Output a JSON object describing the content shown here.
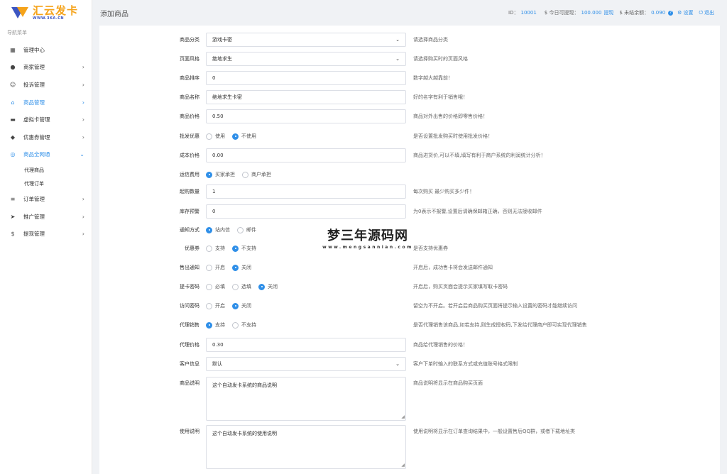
{
  "brand": {
    "title": "汇云发卡",
    "subtitle": "WWW.3KA.CN"
  },
  "sidebar": {
    "caption": "导航菜单",
    "items": [
      {
        "icon": "dashboard-icon",
        "glyph": "▦",
        "label": "管理中心"
      },
      {
        "icon": "user-icon",
        "glyph": "●",
        "label": "商家管理",
        "chevron": "›"
      },
      {
        "icon": "face-icon",
        "glyph": "☺",
        "label": "投诉管理",
        "chevron": "›"
      },
      {
        "icon": "shop-icon",
        "glyph": "⌂",
        "label": "商品管理",
        "chevron": "›",
        "active": true
      },
      {
        "icon": "card-icon",
        "glyph": "▬",
        "label": "虚拟卡管理",
        "chevron": "›"
      },
      {
        "icon": "tag-icon",
        "glyph": "◆",
        "label": "优惠券管理",
        "chevron": "›"
      },
      {
        "icon": "handshake-icon",
        "glyph": "◎",
        "label": "商品全网通",
        "chevron": "⌄",
        "active": true
      },
      {
        "icon": "list-icon",
        "glyph": "≡",
        "label": "订单管理",
        "chevron": "›"
      },
      {
        "icon": "send-icon",
        "glyph": "➤",
        "label": "推广管理",
        "chevron": "›"
      },
      {
        "icon": "dollar-icon",
        "glyph": "$",
        "label": "提现管理",
        "chevron": "›"
      }
    ],
    "subitems": [
      "代理商品",
      "代理订单"
    ]
  },
  "header": {
    "title": "添加商品",
    "id_label": "ID：",
    "id_value": "10001",
    "withdraw_label": "$ 今日可提现：",
    "withdraw_value": "100.000",
    "withdraw_link": "提现",
    "balance_label": "$ 未结余额：",
    "balance_value": "0.090",
    "help_glyph": "?",
    "settings_label": "设置",
    "logout_label": "退出"
  },
  "form": {
    "category": {
      "label": "商品分类",
      "value": "游戏卡密",
      "hint": "请选择商品分类"
    },
    "style": {
      "label": "页面风格",
      "value": "绝地求生",
      "hint": "请选择购买时的页面风格"
    },
    "sort": {
      "label": "商品排序",
      "value": "0",
      "hint": "数字越大越靠前！"
    },
    "name": {
      "label": "商品名称",
      "value": "绝地求生卡密",
      "hint": "好的名字有利于销售哦！"
    },
    "price": {
      "label": "商品价格",
      "value": "0.50",
      "hint": "商品对外出售的价格即零售价格！"
    },
    "wholesale": {
      "label": "批发优惠",
      "options": [
        "使用",
        "不使用"
      ],
      "selected": 1,
      "hint": "是否设置批发购买时使用批发价格！"
    },
    "cost": {
      "label": "成本价格",
      "value": "0.00",
      "hint": "商品进货价,可以不填,填写有利于商户系统的利润统计分析！"
    },
    "shipping": {
      "label": "运信费用",
      "options": [
        "买家承担",
        "商户承担"
      ],
      "selected": 0
    },
    "min_qty": {
      "label": "起购数量",
      "value": "1",
      "hint": "每次购买 最少购买多少件！"
    },
    "stock_alert": {
      "label": "库存预警",
      "value": "0",
      "hint": "为0表示不报警,设置后请确保邮箱正确，否则无法接收邮件"
    },
    "notify": {
      "label": "通知方式",
      "options": [
        "站内信",
        "邮件"
      ],
      "selected": 0
    },
    "coupon": {
      "label": "优惠券",
      "options": [
        "支持",
        "不支持"
      ],
      "selected": 1,
      "hint": "是否支持优惠券"
    },
    "sold_notify": {
      "label": "售出通知",
      "options": [
        "开启",
        "关闭"
      ],
      "selected": 1,
      "hint": "开启后，成功售卡将会发送邮件通知"
    },
    "pickup_pwd": {
      "label": "提卡密码",
      "options": [
        "必填",
        "选填",
        "关闭"
      ],
      "selected": 2,
      "hint": "开启后，购买页面会提示买家填写取卡密码"
    },
    "access_pwd": {
      "label": "访问密码",
      "options": [
        "开启",
        "关闭"
      ],
      "selected": 1,
      "hint": "留空为不开启。若开启后商品购买页面将提示输入设置的密码才能继续访问"
    },
    "agent_sale": {
      "label": "代理销售",
      "options": [
        "支持",
        "不支持"
      ],
      "selected": 0,
      "hint": "是否代理销售该商品,如若支持,则生成授权码,下发给代理商户即可实现代理销售"
    },
    "agent_price": {
      "label": "代理价格",
      "value": "0.30",
      "hint": "商品给代理销售的价格！"
    },
    "customer_info": {
      "label": "客户信息",
      "value": "默认",
      "hint": "客户下单时输入的联系方式或充值账号格式限制"
    },
    "description": {
      "label": "商品说明",
      "value": "这个自动发卡系统的商品说明",
      "hint": "商品说明将显示在商品购买页面"
    },
    "usage": {
      "label": "使用说明",
      "value": "这个自动发卡系统的使用说明",
      "hint": "使用说明将显示在订单查询结果中，一般设置售后QQ群，或者下载地址类"
    }
  },
  "watermark": {
    "title": "梦三年源码网",
    "subtitle": "www.mengsannian.com"
  }
}
